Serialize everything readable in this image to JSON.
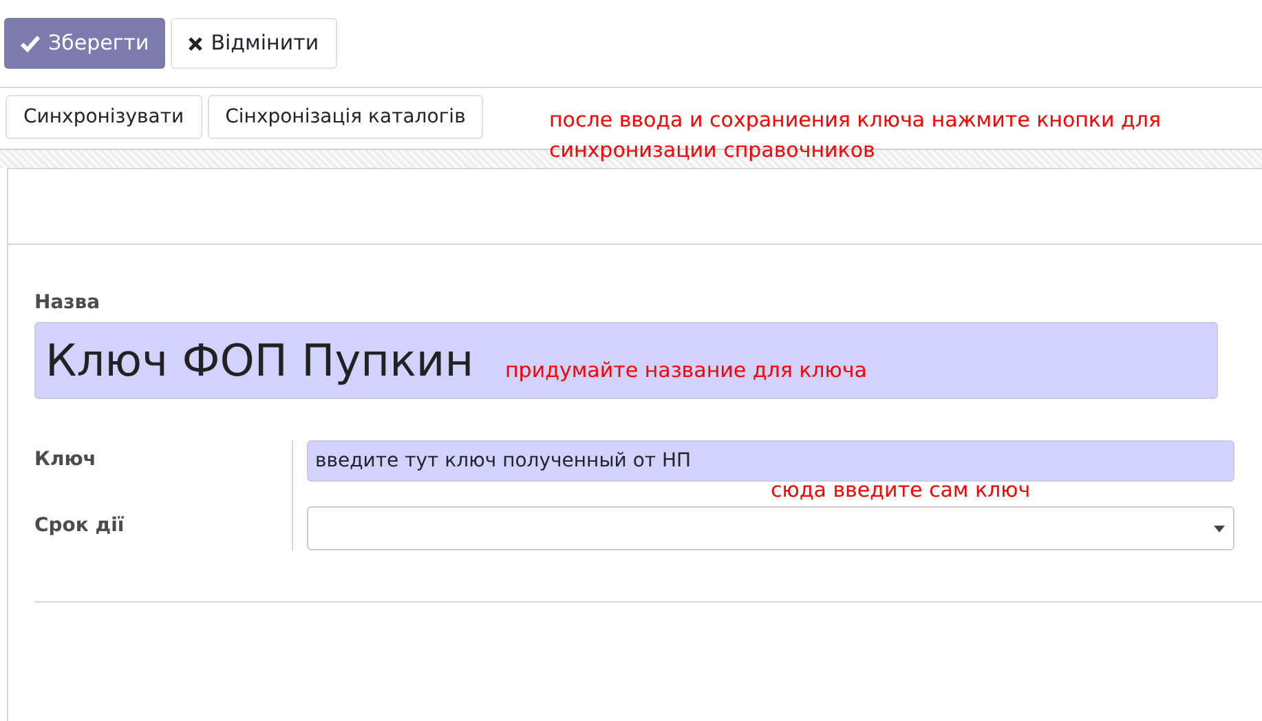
{
  "toolbar": {
    "buttons": [
      {
        "label": "Зберегти",
        "kind": "primary"
      },
      {
        "label": "Відмінити",
        "kind": "secondary"
      }
    ]
  },
  "actions": {
    "buttons": [
      {
        "label": "Синхронізувати"
      },
      {
        "label": "Сінхронізація каталогів"
      }
    ]
  },
  "annotations": [
    {
      "kind": "actions",
      "text": "после ввода и сохраниения ключа нажмите кнопки для синхронизации справочников"
    },
    {
      "kind": "name",
      "text": "придумайте название для ключа"
    },
    {
      "kind": "key",
      "text": "сюда введите сам ключ"
    }
  ],
  "form": {
    "name_label": "Назва",
    "name_value": "Ключ ФОП Пупкин",
    "fields": [
      {
        "label": "Ключ",
        "kind": "text",
        "value": "введите тут ключ полученный от НП"
      },
      {
        "label": "Срок дії",
        "kind": "select"
      }
    ]
  }
}
